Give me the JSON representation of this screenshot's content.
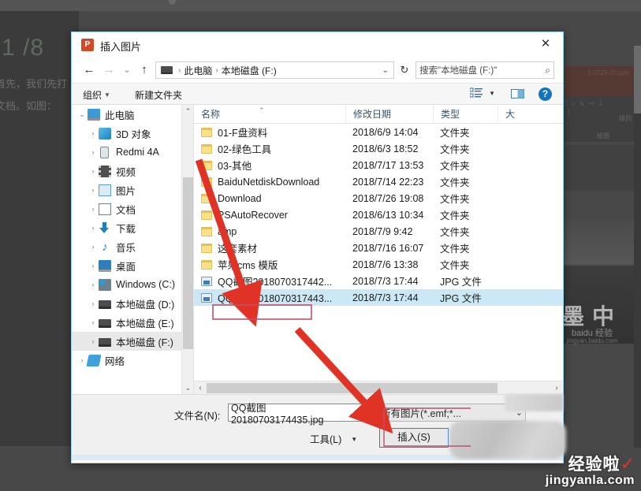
{
  "colors": {
    "accent": "#2f7fd0",
    "selection": "#cce8f7",
    "annotation_red": "#e03326",
    "help_blue": "#1176bc",
    "folder_yellow": "#fbe08a"
  },
  "background": {
    "page_number": "1 /8",
    "line1": "首先，我们先打",
    "line2": "文档。如图：",
    "ppt_filename": "3-0723-20.pptx",
    "ribbon_group_arrange": "排列",
    "ribbon_group_draw": "绘图",
    "photo_text": "墨中",
    "photo_sub": "baidu 经验",
    "photo_sub2": "jingyan.baidu.com",
    "shapes_glyphs": "＼ □ ○ ↳ ⇨ ⇩ ∧ ( )"
  },
  "dialog": {
    "app_icon_label": "P",
    "title": "插入图片",
    "close_label": "✕",
    "nav": {
      "back_label": "←",
      "forward_label": "→",
      "recent_label": "⌄",
      "up_label": "↑"
    },
    "address": {
      "separator": "›",
      "crumbs": [
        "此电脑",
        "本地磁盘 (F:)"
      ],
      "dropdown_caret": "⌄",
      "refresh_label": "↻"
    },
    "search": {
      "value": "搜索\"本地磁盘 (F:)\"",
      "placeholder": "搜索\"本地磁盘 (F:)\"",
      "icon": "search-icon"
    },
    "toolbar": {
      "organize_label": "组织",
      "new_folder_label": "新建文件夹",
      "caret": "▼",
      "view_caret": "▼",
      "help_label": "?"
    },
    "navpane": {
      "scroll_up": "⌃",
      "scroll_down": "⌄",
      "items": [
        {
          "label": "此电脑",
          "twisty": "⌄",
          "icon": "pc-icon",
          "indent": 0,
          "selected": false
        },
        {
          "label": "3D 对象",
          "twisty": "›",
          "icon": "3d-icon",
          "indent": 1,
          "selected": false
        },
        {
          "label": "Redmi 4A",
          "twisty": "›",
          "icon": "phone-icon",
          "indent": 1,
          "selected": false
        },
        {
          "label": "视频",
          "twisty": "›",
          "icon": "video-icon",
          "indent": 1,
          "selected": false
        },
        {
          "label": "图片",
          "twisty": "›",
          "icon": "picture-icon",
          "indent": 1,
          "selected": false
        },
        {
          "label": "文档",
          "twisty": "›",
          "icon": "document-icon",
          "indent": 1,
          "selected": false
        },
        {
          "label": "下载",
          "twisty": "›",
          "icon": "download-icon",
          "indent": 1,
          "selected": false
        },
        {
          "label": "音乐",
          "twisty": "›",
          "icon": "music-icon",
          "indent": 1,
          "selected": false
        },
        {
          "label": "桌面",
          "twisty": "›",
          "icon": "desktop-icon",
          "indent": 1,
          "selected": false
        },
        {
          "label": "Windows (C:)",
          "twisty": "›",
          "icon": "windows-drive-icon",
          "indent": 1,
          "selected": false
        },
        {
          "label": "本地磁盘 (D:)",
          "twisty": "›",
          "icon": "drive-icon",
          "indent": 1,
          "selected": false
        },
        {
          "label": "本地磁盘 (E:)",
          "twisty": "›",
          "icon": "drive-icon",
          "indent": 1,
          "selected": false
        },
        {
          "label": "本地磁盘 (F:)",
          "twisty": "›",
          "icon": "drive-icon",
          "indent": 1,
          "selected": true
        },
        {
          "label": "网络",
          "twisty": "›",
          "icon": "network-icon",
          "indent": 0,
          "selected": false
        }
      ]
    },
    "filelist": {
      "columns": [
        "名称",
        "修改日期",
        "类型",
        "大"
      ],
      "sort_indicator": "⌃",
      "hscroll_left": "‹",
      "hscroll_right": "›",
      "rows": [
        {
          "name": "01-F盘资料",
          "date": "2018/6/9 14:04",
          "type": "文件夹",
          "icon": "folder-icon",
          "selected": false
        },
        {
          "name": "02-绿色工具",
          "date": "2018/6/3 18:52",
          "type": "文件夹",
          "icon": "folder-icon",
          "selected": false
        },
        {
          "name": "03-其他",
          "date": "2018/7/17 13:53",
          "type": "文件夹",
          "icon": "folder-icon",
          "selected": false
        },
        {
          "name": "BaiduNetdiskDownload",
          "date": "2018/7/14 22:23",
          "type": "文件夹",
          "icon": "folder-icon",
          "selected": false
        },
        {
          "name": "Download",
          "date": "2018/7/26 19:08",
          "type": "文件夹",
          "icon": "folder-icon",
          "selected": false
        },
        {
          "name": "PSAutoRecover",
          "date": "2018/6/13 10:34",
          "type": "文件夹",
          "icon": "folder-icon",
          "selected": false
        },
        {
          "name": "amp",
          "date": "2018/7/9 9:42",
          "type": "文件夹",
          "icon": "folder-icon",
          "selected": false
        },
        {
          "name": "这套素材",
          "date": "2018/7/16 16:07",
          "type": "文件夹",
          "icon": "folder-icon",
          "selected": false
        },
        {
          "name": "苹果cms 模版",
          "date": "2018/7/6 13:38",
          "type": "文件夹",
          "icon": "folder-icon",
          "selected": false
        },
        {
          "name": "QQ截图2018070317442...",
          "date": "2018/7/3 17:44",
          "type": "JPG 文件",
          "icon": "jpg-icon",
          "selected": false
        },
        {
          "name": "QQ截图2018070317443...",
          "date": "2018/7/3 17:44",
          "type": "JPG 文件",
          "icon": "jpg-icon",
          "selected": true
        }
      ]
    },
    "form": {
      "filename_label": "文件名(N):",
      "filename_value": "QQ截图20180703174435.jpg",
      "filename_caret": "⌄",
      "filetype_value": "所有图片(*.emf;*...",
      "filetype_caret": "⌄",
      "tools_label": "工具(L)",
      "tools_caret": "▼",
      "insert_label": "插入(S)",
      "cancel_label": ""
    }
  },
  "watermark": {
    "cn": "经验啦",
    "check": "✓",
    "en": "jingyanla.com"
  }
}
